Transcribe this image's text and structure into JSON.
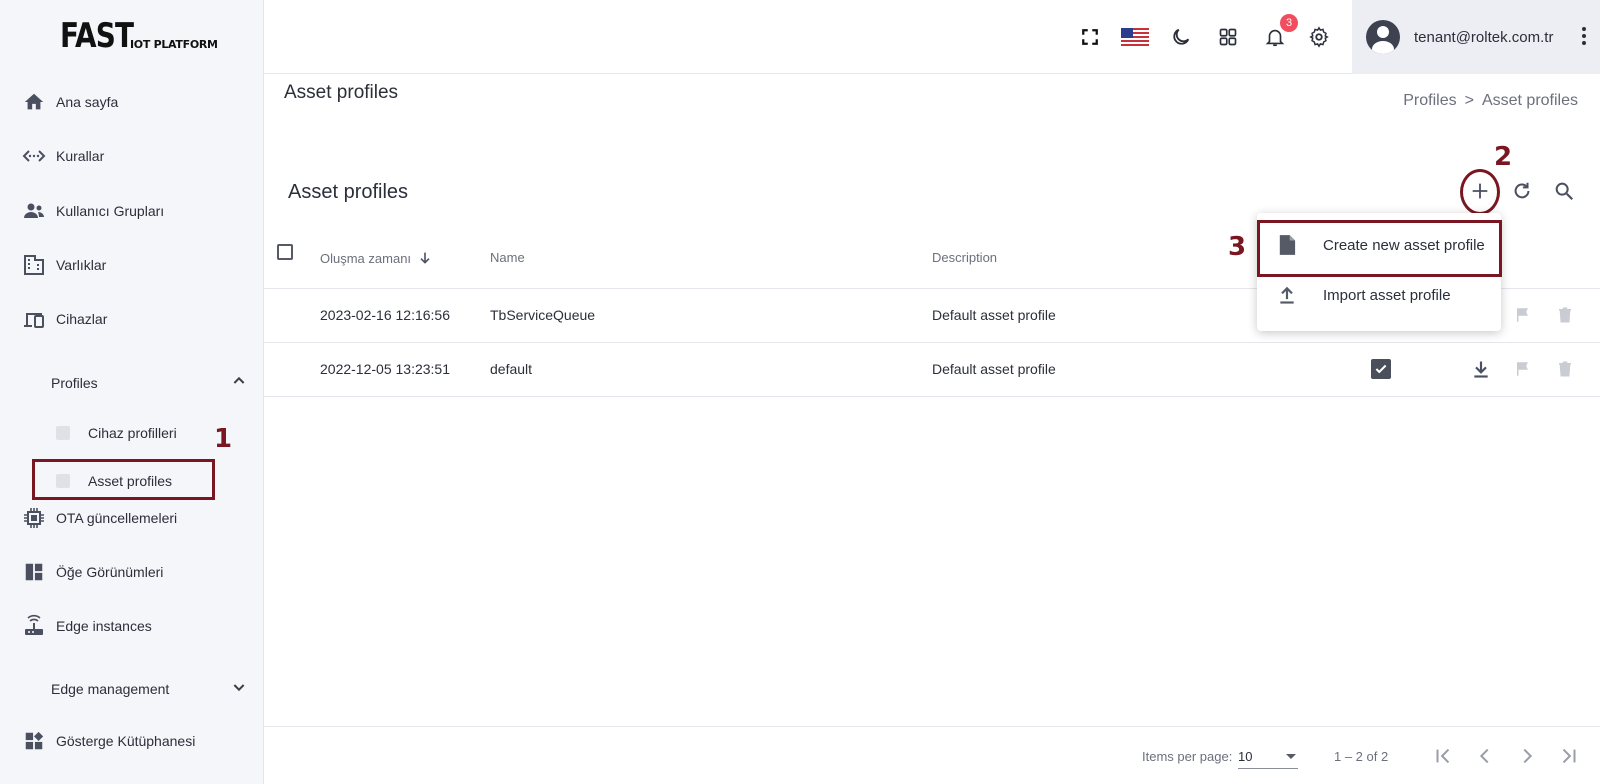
{
  "logo": {
    "main": "FAST",
    "sub": "IOT PLATFORM"
  },
  "sidebar": {
    "items": [
      {
        "label": "Ana sayfa",
        "icon": "home-icon"
      },
      {
        "label": "Kurallar",
        "icon": "rule-chain-icon"
      },
      {
        "label": "Kullanıcı Grupları",
        "icon": "users-icon"
      },
      {
        "label": "Varlıklar",
        "icon": "building-icon"
      },
      {
        "label": "Cihazlar",
        "icon": "devices-icon"
      }
    ],
    "profiles_group": {
      "label": "Profiles",
      "expanded": true,
      "children": [
        "Cihaz profilleri",
        "Asset profiles"
      ]
    },
    "items2": [
      {
        "label": "OTA güncellemeleri",
        "icon": "chip-icon"
      },
      {
        "label": "Öğe Görünümleri",
        "icon": "dashboard-icon"
      },
      {
        "label": "Edge instances",
        "icon": "router-icon"
      }
    ],
    "edge_group": {
      "label": "Edge management",
      "expanded": false
    },
    "items3": [
      {
        "label": "Gösterge Kütüphanesi",
        "icon": "widgets-icon"
      }
    ]
  },
  "topbar": {
    "notification_count": "3",
    "user_email": "tenant@roltek.com.tr"
  },
  "page": {
    "title": "Asset profiles",
    "breadcrumb": [
      "Profiles",
      ">",
      "Asset profiles"
    ],
    "table_title": "Asset profiles"
  },
  "table": {
    "columns": [
      "Oluşma zamanı",
      "Name",
      "Description"
    ],
    "rows": [
      {
        "created": "2023-02-16 12:16:56",
        "name": "TbServiceQueue",
        "description": "Default asset profile",
        "is_default": false
      },
      {
        "created": "2022-12-05 13:23:51",
        "name": "default",
        "description": "Default asset profile",
        "is_default": true
      }
    ]
  },
  "menu": {
    "items": [
      "Create new asset profile",
      "Import asset profile"
    ]
  },
  "annotations": [
    "1",
    "2",
    "3"
  ],
  "footer": {
    "items_per_page_label": "Items per page:",
    "items_per_page_value": "10",
    "range": "1 – 2 of 2"
  },
  "colors": {
    "annotation": "#7a1622",
    "badge": "#f04e5e",
    "sidebar_bg": "#f5f6fa"
  }
}
